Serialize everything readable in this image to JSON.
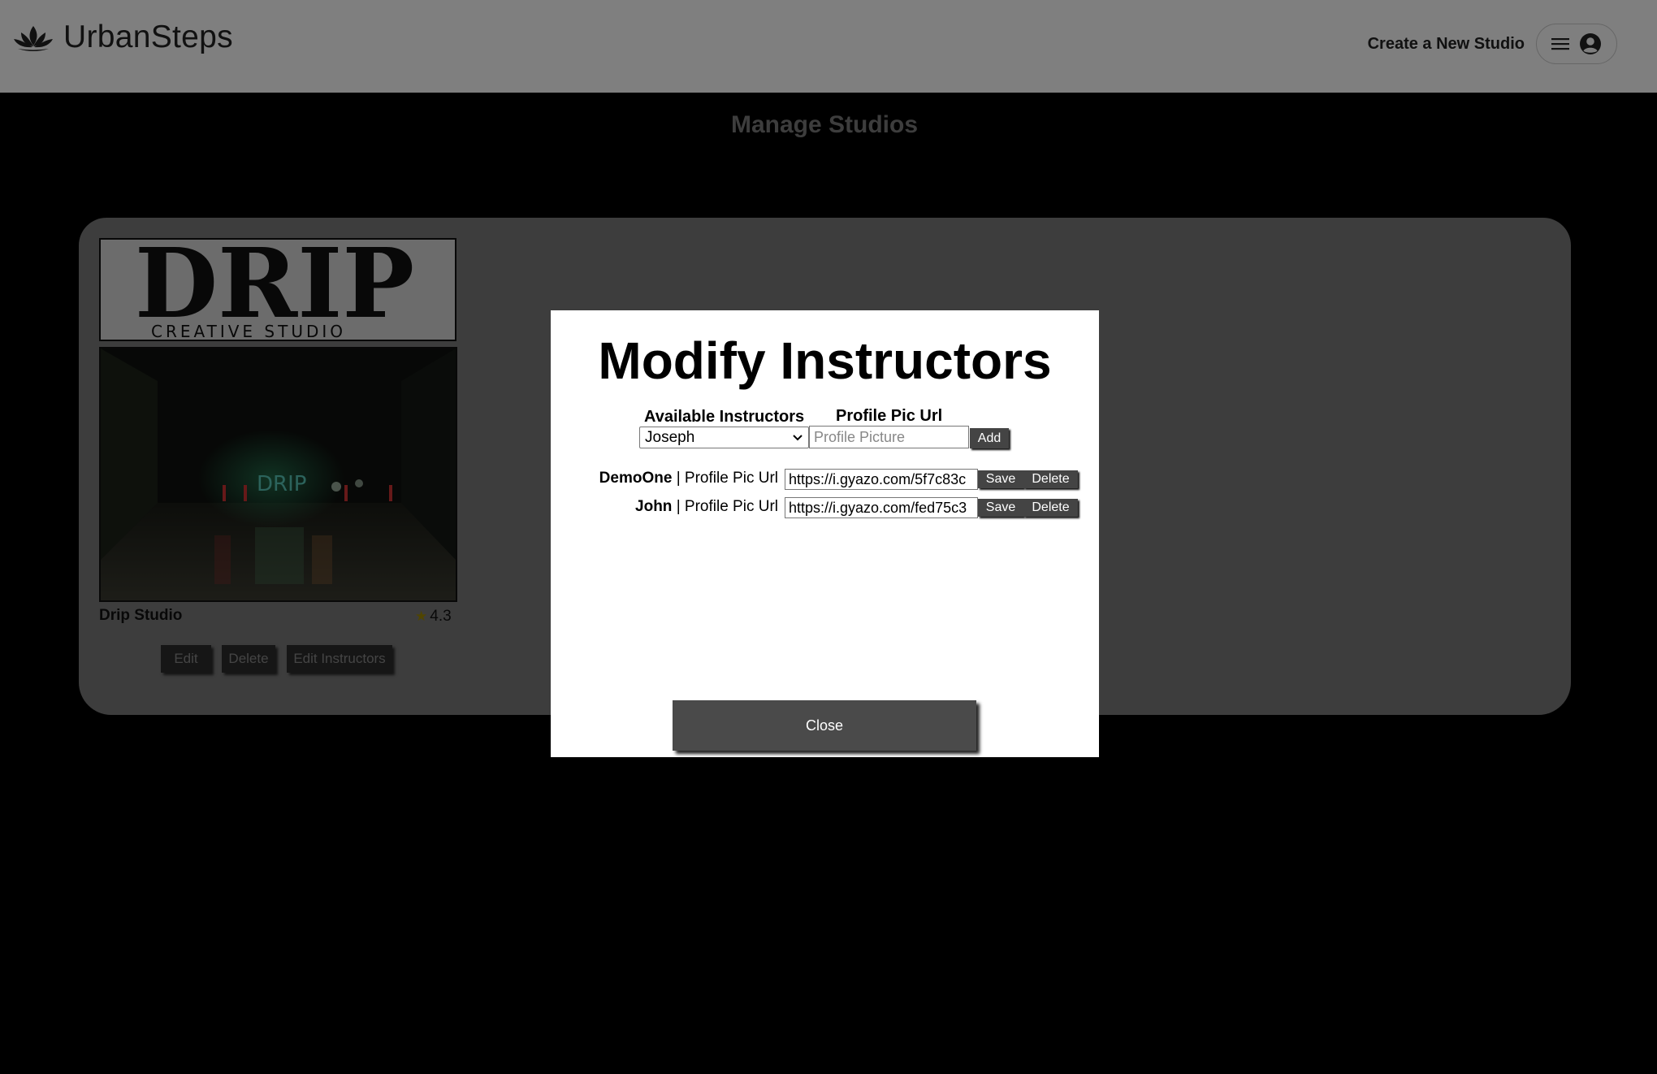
{
  "header": {
    "brand": "UrbanSteps",
    "create_link": "Create a New Studio",
    "menu_icon": "hamburger-icon",
    "account_icon": "user-circle-icon"
  },
  "page": {
    "title": "Manage Studios"
  },
  "studio_card": {
    "logo_text_main": "DRIP",
    "logo_text_sub": "CREATIVE STUDIO",
    "photo_sign": "DRIP",
    "name": "Drip Studio",
    "rating": "4.3",
    "rating_icon": "star-icon",
    "buttons": {
      "edit": "Edit",
      "delete": "Delete",
      "edit_instructors": "Edit Instructors"
    }
  },
  "modal": {
    "title": "Modify Instructors",
    "available_label": "Available Instructors",
    "profile_pic_label": "Profile Pic Url",
    "selected_instructor": "Joseph",
    "profile_placeholder": "Profile Picture",
    "add_button": "Add",
    "instructors": [
      {
        "name": "DemoOne",
        "separator": " | Profile Pic Url",
        "url": "https://i.gyazo.com/5f7c83c"
      },
      {
        "name": "John",
        "separator": " | Profile Pic Url",
        "url": "https://i.gyazo.com/fed75c3"
      }
    ],
    "save_button": "Save",
    "delete_button": "Delete",
    "close_button": "Close"
  },
  "colors": {
    "header_bg": "#ffffff",
    "page_bg": "#000000",
    "panel_bg": "#7a7a7a",
    "button_bg": "#444444",
    "overlay": "rgba(0,0,0,0.5)"
  }
}
